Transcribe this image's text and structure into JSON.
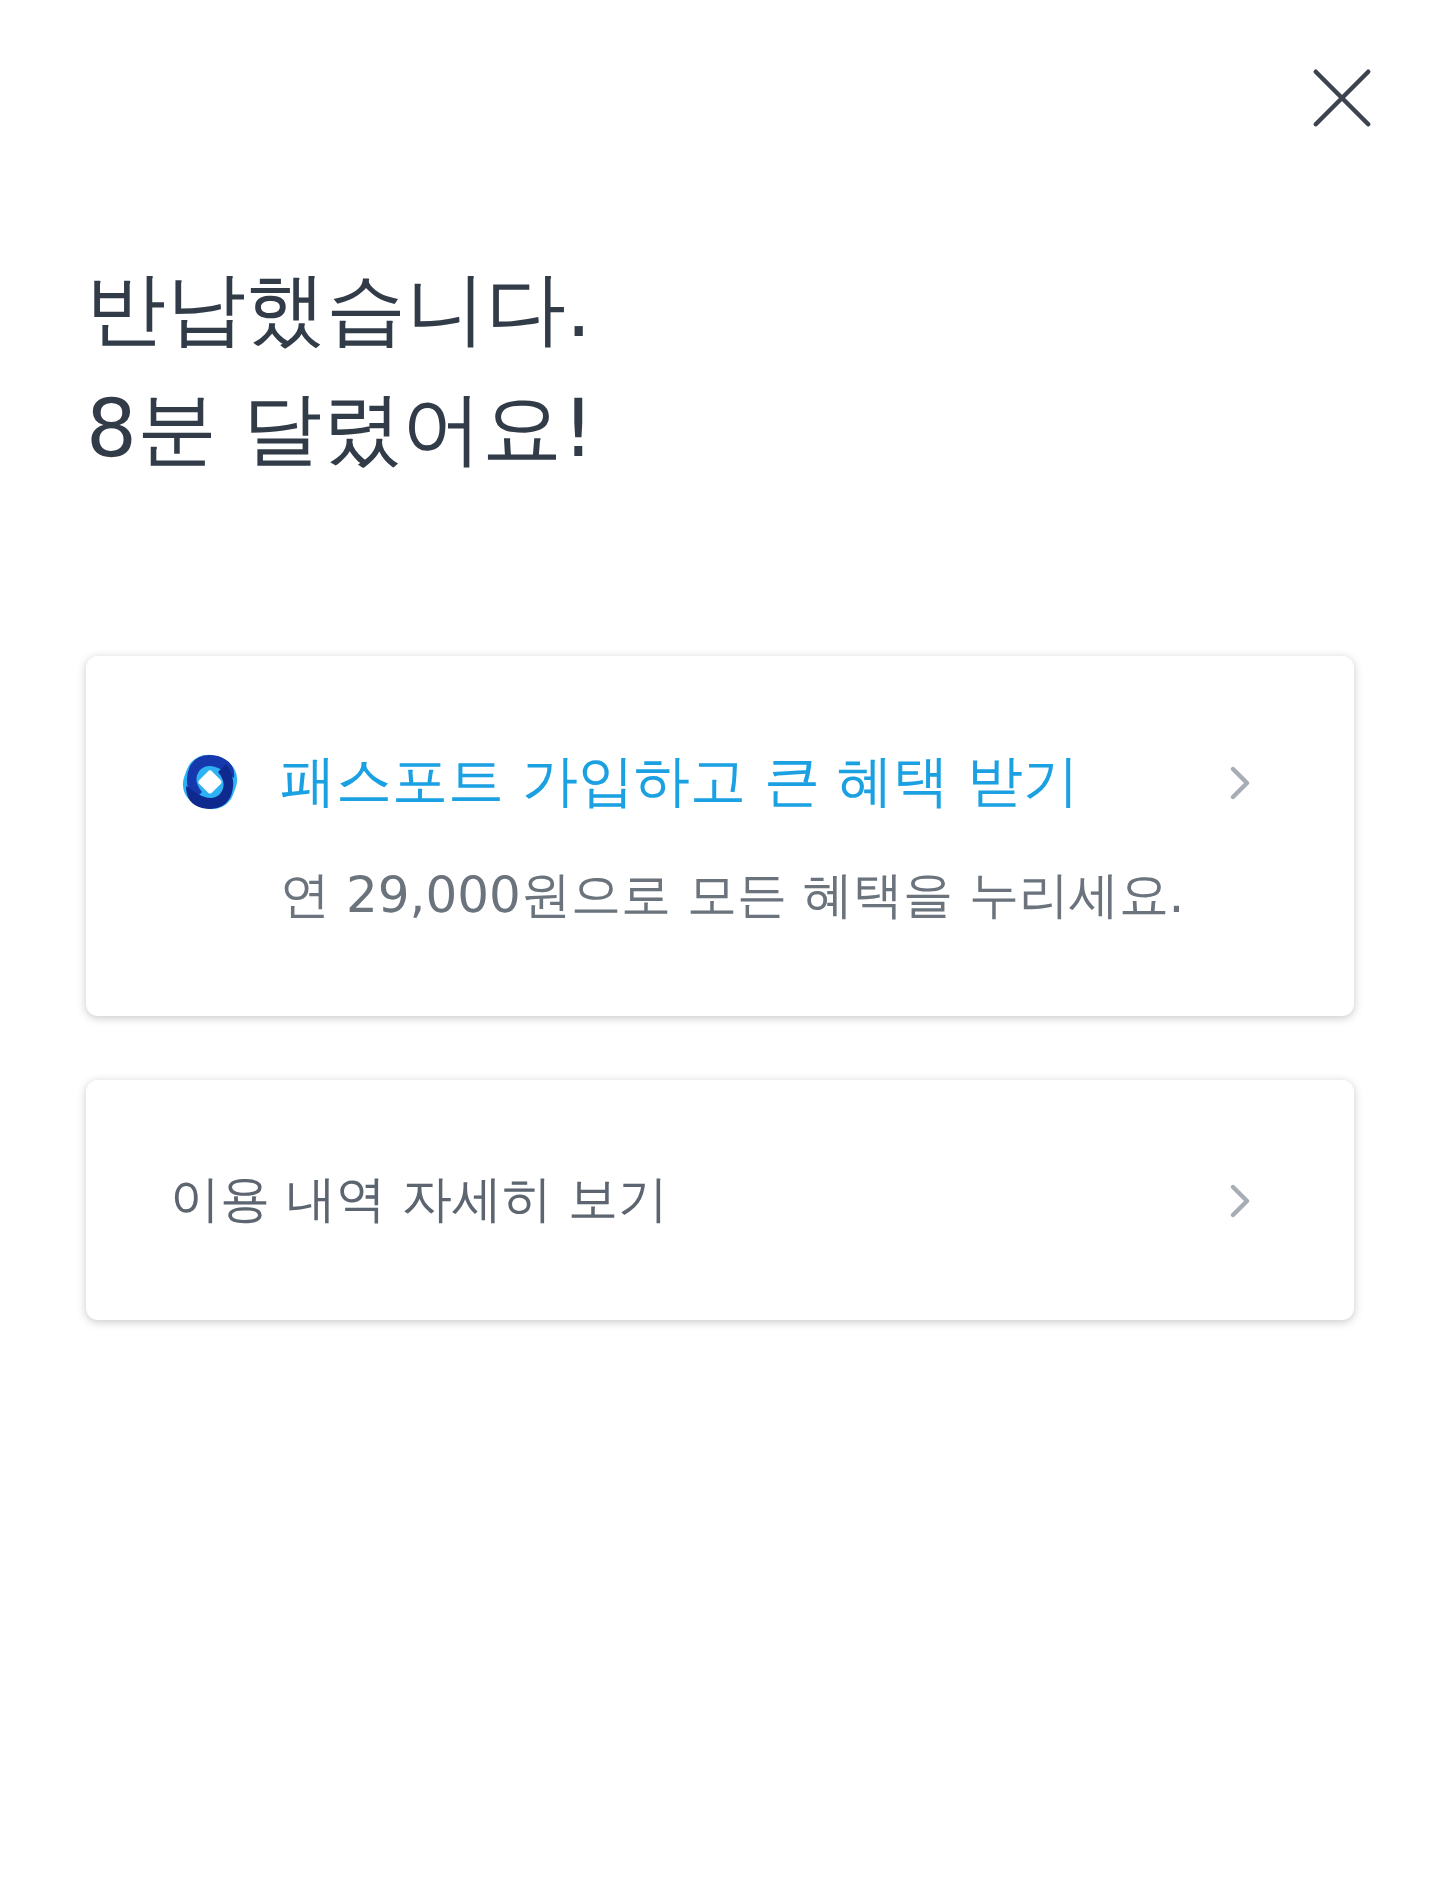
{
  "heading": {
    "lines": [
      "반납했습니다.",
      "8분 달렸어요!"
    ]
  },
  "cards": [
    {
      "kind": "promo",
      "title": "패스포트 가입하고 큰 혜택 받기",
      "subtitle": "연 29,000원으로 모든 혜택을 누리세요."
    },
    {
      "kind": "link",
      "title": "이용 내역 자세히 보기"
    }
  ]
}
